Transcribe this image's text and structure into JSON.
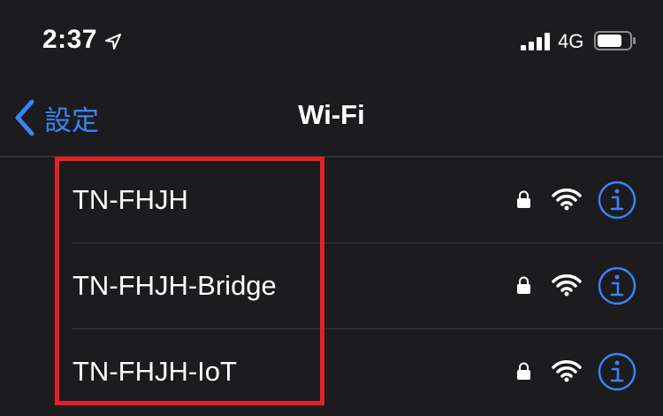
{
  "status_bar": {
    "time": "2:37",
    "carrier": "4G"
  },
  "nav": {
    "back_label": "設定",
    "title": "Wi-Fi"
  },
  "networks": [
    {
      "name": "TN-FHJH",
      "secured": true
    },
    {
      "name": "TN-FHJH-Bridge",
      "secured": true
    },
    {
      "name": "TN-FHJH-IoT",
      "secured": true
    }
  ],
  "icons": {
    "location": "location-arrow-icon",
    "signal": "cellular-signal-icon",
    "battery": "battery-icon",
    "back": "chevron-left-icon",
    "lock": "lock-icon",
    "wifi": "wifi-icon",
    "info": "info-icon"
  },
  "colors": {
    "background": "#1c1c1e",
    "accent": "#3b82f6",
    "highlight": "#e3202a",
    "text": "#ffffff"
  }
}
